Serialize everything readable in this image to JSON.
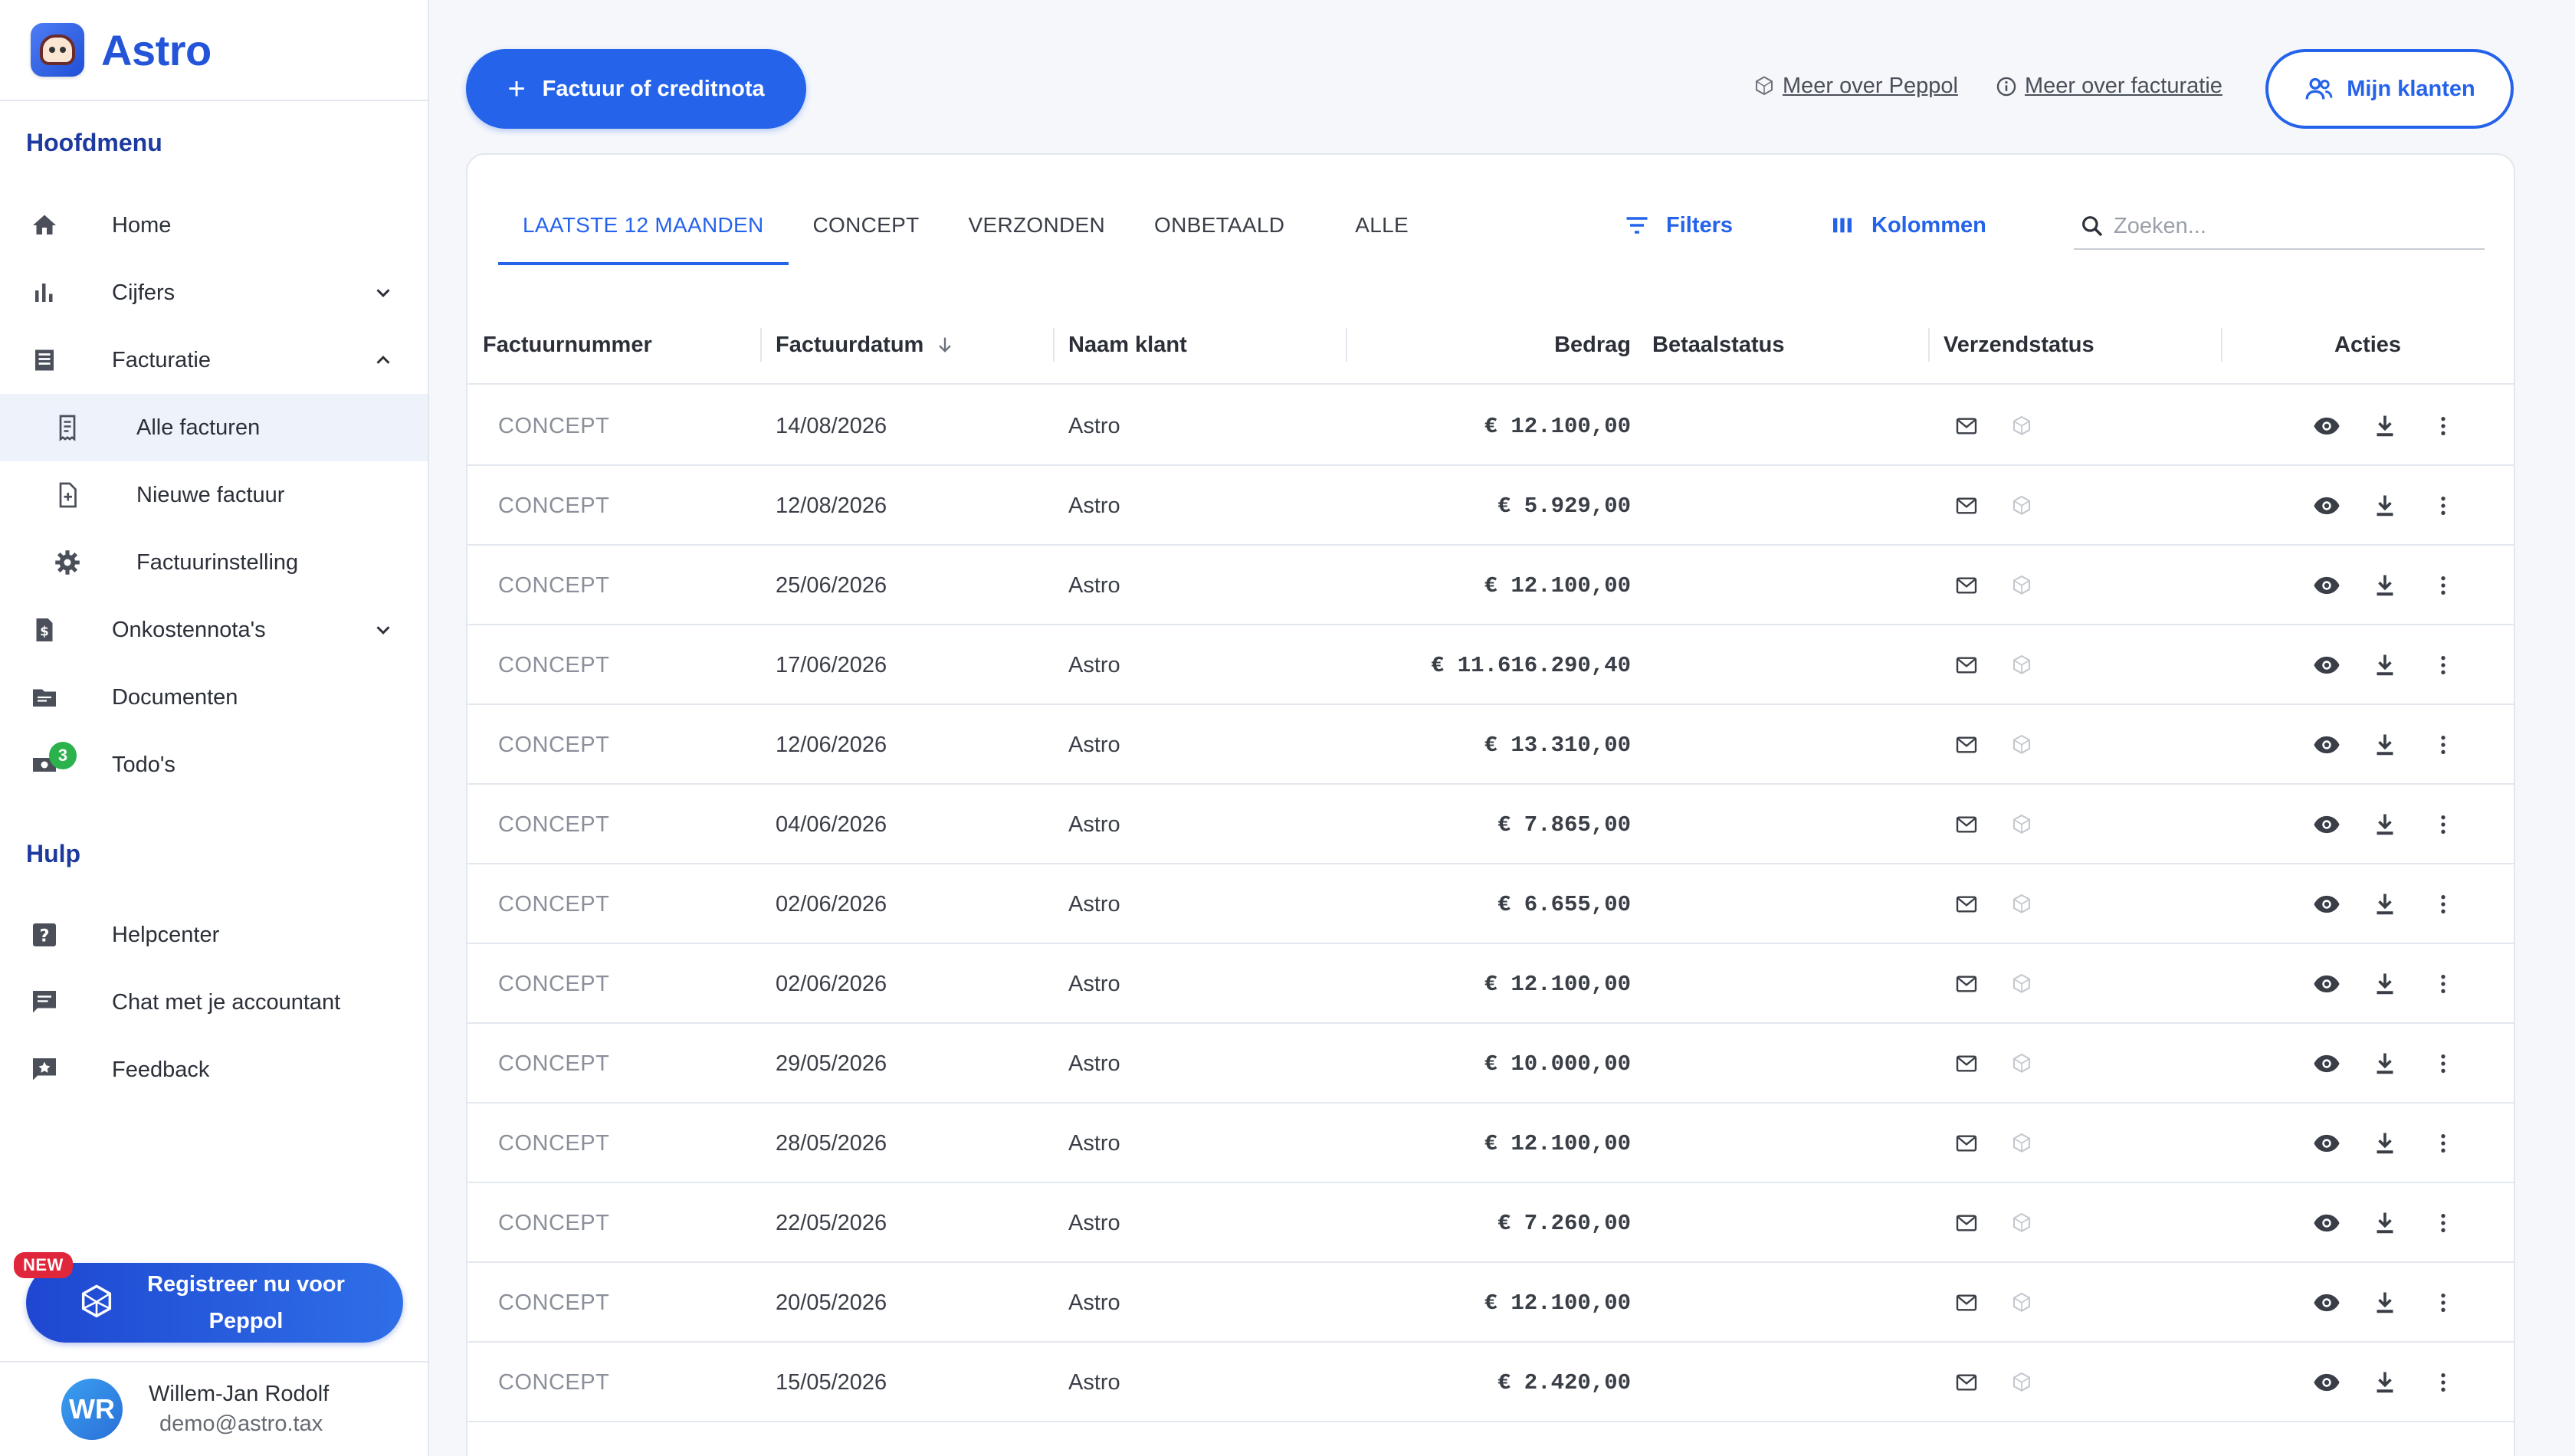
{
  "brand": {
    "name": "Astro"
  },
  "sidebar": {
    "main_title": "Hoofdmenu",
    "help_title": "Hulp",
    "items": [
      {
        "id": "home",
        "label": "Home"
      },
      {
        "id": "cijfers",
        "label": "Cijfers"
      },
      {
        "id": "facturatie",
        "label": "Facturatie"
      },
      {
        "id": "alle-facturen",
        "label": "Alle facturen"
      },
      {
        "id": "nieuwe-factuur",
        "label": "Nieuwe factuur"
      },
      {
        "id": "factuurinstelling",
        "label": "Factuurinstelling"
      },
      {
        "id": "onkostennotas",
        "label": "Onkostennota's"
      },
      {
        "id": "documenten",
        "label": "Documenten"
      },
      {
        "id": "todos",
        "label": "Todo's",
        "badge": "3"
      }
    ],
    "help_items": [
      {
        "id": "helpcenter",
        "label": "Helpcenter"
      },
      {
        "id": "chat",
        "label": "Chat met je accountant"
      },
      {
        "id": "feedback",
        "label": "Feedback"
      }
    ],
    "peppol_cta": {
      "badge": "NEW",
      "line1": "Registreer nu voor",
      "line2": "Peppol"
    },
    "user": {
      "initials": "WR",
      "name": "Willem-Jan Rodolf",
      "email": "demo@astro.tax"
    }
  },
  "topbar": {
    "new_button": "Factuur of creditnota",
    "link_peppol": "Meer over Peppol",
    "link_facturatie": "Meer over facturatie",
    "clients_button": "Mijn klanten"
  },
  "tabs": [
    {
      "label": "LAATSTE 12 MAANDEN",
      "active": true
    },
    {
      "label": "CONCEPT"
    },
    {
      "label": "VERZONDEN"
    },
    {
      "label": "ONBETAALD"
    },
    {
      "label": "ALLE"
    }
  ],
  "toolbar": {
    "filters": "Filters",
    "columns": "Kolommen",
    "search_placeholder": "Zoeken..."
  },
  "table": {
    "columns": {
      "number": "Factuurnummer",
      "date": "Factuurdatum",
      "client": "Naam klant",
      "amount": "Bedrag",
      "pay_status": "Betaalstatus",
      "send_status": "Verzendstatus",
      "actions": "Acties"
    },
    "rows": [
      {
        "number": "CONCEPT",
        "date": "14/08/2026",
        "client": "Astro",
        "amount": "€ 12.100,00"
      },
      {
        "number": "CONCEPT",
        "date": "12/08/2026",
        "client": "Astro",
        "amount": "€ 5.929,00"
      },
      {
        "number": "CONCEPT",
        "date": "25/06/2026",
        "client": "Astro",
        "amount": "€ 12.100,00"
      },
      {
        "number": "CONCEPT",
        "date": "17/06/2026",
        "client": "Astro",
        "amount": "€ 11.616.290,40"
      },
      {
        "number": "CONCEPT",
        "date": "12/06/2026",
        "client": "Astro",
        "amount": "€ 13.310,00"
      },
      {
        "number": "CONCEPT",
        "date": "04/06/2026",
        "client": "Astro",
        "amount": "€ 7.865,00"
      },
      {
        "number": "CONCEPT",
        "date": "02/06/2026",
        "client": "Astro",
        "amount": "€ 6.655,00"
      },
      {
        "number": "CONCEPT",
        "date": "02/06/2026",
        "client": "Astro",
        "amount": "€ 12.100,00"
      },
      {
        "number": "CONCEPT",
        "date": "29/05/2026",
        "client": "Astro",
        "amount": "€ 10.000,00"
      },
      {
        "number": "CONCEPT",
        "date": "28/05/2026",
        "client": "Astro",
        "amount": "€ 12.100,00"
      },
      {
        "number": "CONCEPT",
        "date": "22/05/2026",
        "client": "Astro",
        "amount": "€ 7.260,00"
      },
      {
        "number": "CONCEPT",
        "date": "20/05/2026",
        "client": "Astro",
        "amount": "€ 12.100,00"
      },
      {
        "number": "CONCEPT",
        "date": "15/05/2026",
        "client": "Astro",
        "amount": "€ 2.420,00"
      }
    ]
  },
  "colors": {
    "accent": "#2563eb",
    "brand": "#2455d9",
    "badge_green": "#2bb24c",
    "badge_red": "#e0263a"
  }
}
